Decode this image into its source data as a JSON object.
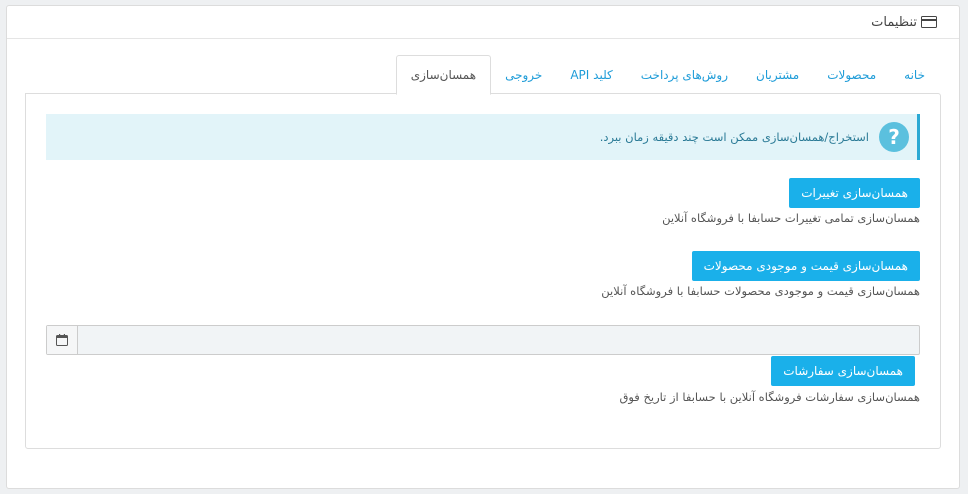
{
  "header": {
    "title": "تنظیمات",
    "icon": "credit-card-icon"
  },
  "tabs": [
    {
      "id": "home",
      "label": "خانه"
    },
    {
      "id": "products",
      "label": "محصولات"
    },
    {
      "id": "customers",
      "label": "مشتریان"
    },
    {
      "id": "payment",
      "label": "روش‌های پرداخت"
    },
    {
      "id": "api",
      "label": "کلید API"
    },
    {
      "id": "export",
      "label": "خروجی"
    },
    {
      "id": "sync",
      "label": "همسان‌سازی",
      "active": true
    }
  ],
  "alert": {
    "icon": "question-icon",
    "text": "استخراج/همسان‌سازی ممکن است چند دقیقه زمان ببرد."
  },
  "sync_changes": {
    "button": "همسان‌سازی تغییرات",
    "description": "همسان‌سازی تمامی تغییرات حسابفا با فروشگاه آنلاین"
  },
  "sync_products": {
    "button": "همسان‌سازی قیمت و موجودی محصولات",
    "description": "همسان‌سازی قیمت و موجودی محصولات حسابفا با فروشگاه آنلاین"
  },
  "date": {
    "value": "",
    "placeholder": "",
    "icon": "calendar-icon"
  },
  "sync_orders": {
    "button": "همسان‌سازی سفارشات",
    "description": "همسان‌سازی سفارشات فروشگاه آنلاین با حسابفا از تاریخ فوق"
  },
  "colors": {
    "primary": "#1ab0ea",
    "alert_bg": "#e2f4f9",
    "alert_border": "#2ba9d4",
    "link": "#1e9cd8"
  }
}
